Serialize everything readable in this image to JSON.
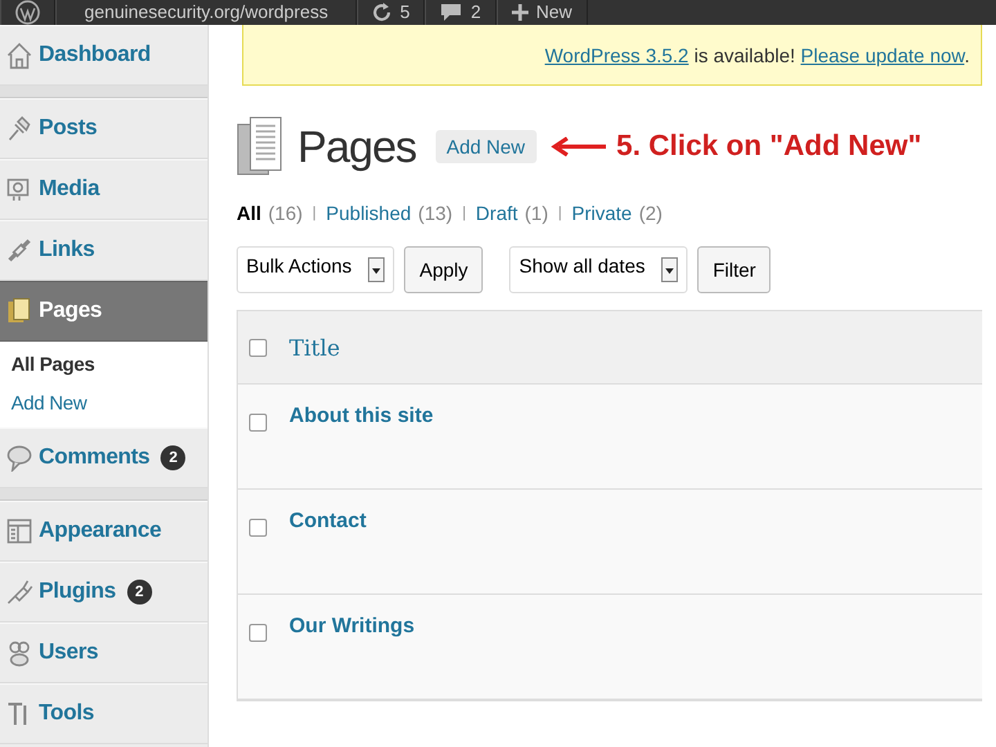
{
  "admin_bar": {
    "site": "genuinesecurity.org/wordpress",
    "updates": "5",
    "comments": "2",
    "new": "New"
  },
  "sidebar": {
    "items": [
      {
        "label": "Dashboard",
        "selected": false,
        "separator_after": true
      },
      {
        "label": "Posts",
        "selected": false,
        "separator_after": false
      },
      {
        "label": "Media",
        "selected": false,
        "separator_after": false
      },
      {
        "label": "Links",
        "selected": false,
        "separator_after": false
      },
      {
        "label": "Pages",
        "selected": true,
        "separator_after": false,
        "children": [
          {
            "label": "All Pages",
            "selected": true
          },
          {
            "label": "Add New",
            "selected": false
          }
        ]
      },
      {
        "label": "Comments",
        "selected": false,
        "badge": "2",
        "separator_after": true
      },
      {
        "label": "Appearance",
        "selected": false,
        "separator_after": false
      },
      {
        "label": "Plugins",
        "selected": false,
        "badge": "2",
        "separator_after": false
      },
      {
        "label": "Users",
        "selected": false,
        "separator_after": false
      },
      {
        "label": "Tools",
        "selected": false,
        "separator_after": false
      }
    ]
  },
  "notice": {
    "version_link": "WordPress 3.5.2",
    "text": "is available!",
    "update_link": "Please update now",
    "end": "."
  },
  "heading": {
    "title": "Pages",
    "add_new": "Add New"
  },
  "annotation": "5. Click on \"Add New\"",
  "filters": [
    {
      "label": "All",
      "count": "(16)",
      "selected": true
    },
    {
      "separator": "|",
      "label": "Published",
      "count": "(13)",
      "selected": false
    },
    {
      "separator": "|",
      "label": "Draft",
      "count": "(1)",
      "selected": false
    },
    {
      "separator": "|",
      "label": "Private",
      "count": "(2)",
      "selected": false
    }
  ],
  "toolbar": {
    "bulk": "Bulk Actions",
    "apply": "Apply",
    "dates": "Show all dates",
    "filter": "Filter"
  },
  "table": {
    "columns": [
      "Title"
    ],
    "select_all_checked": false,
    "rows": [
      {
        "title": "About this site",
        "checked": false
      },
      {
        "title": "Contact",
        "checked": false
      },
      {
        "title": "Our Writings",
        "checked": false
      }
    ]
  }
}
